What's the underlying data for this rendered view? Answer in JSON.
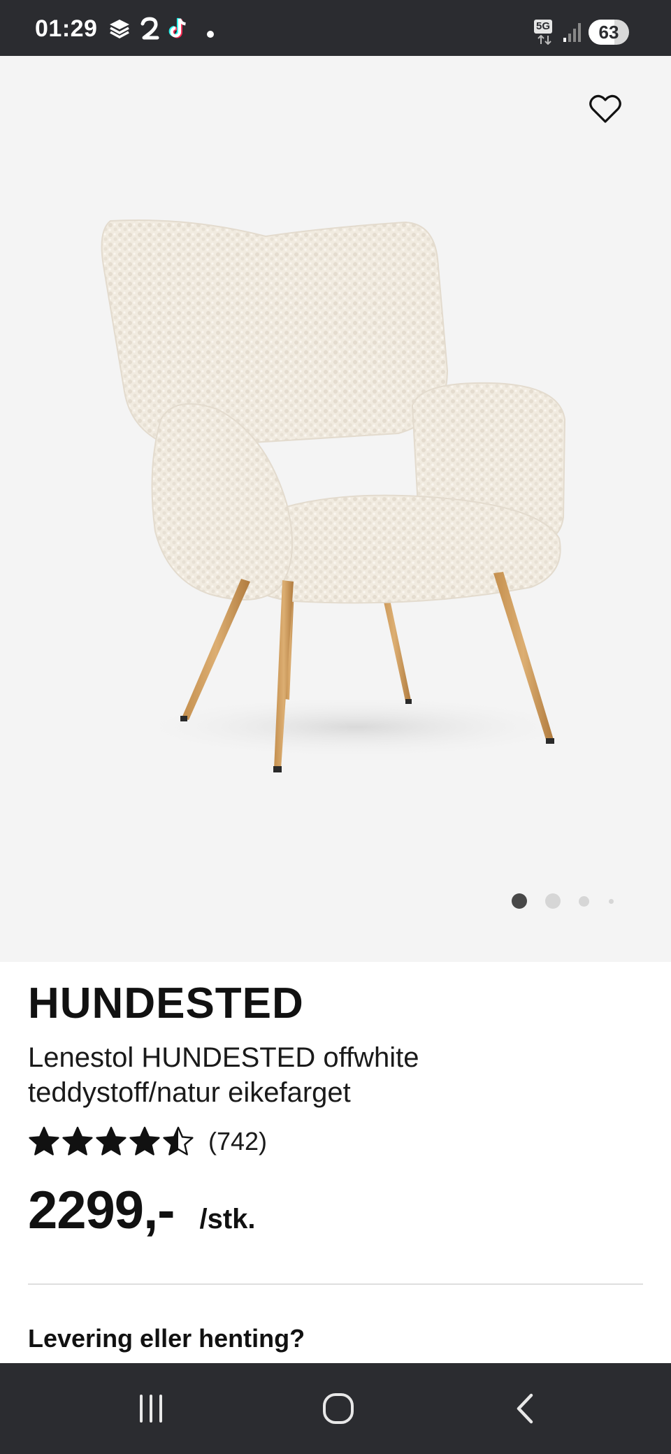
{
  "status_bar": {
    "time": "01:29",
    "network_label": "5G",
    "battery_level": "63",
    "battery_fraction": 0.63,
    "notification_icons": [
      "layers-icon",
      "number-2-icon",
      "tiktok-icon"
    ]
  },
  "product": {
    "image_alt_icon": "armchair-icon",
    "carousel": {
      "count": 4,
      "active_index": 0
    },
    "brand": "HUNDESTED",
    "description": "Lenestol HUNDESTED offwhite teddystoff/natur eikefarget",
    "rating": {
      "value": 4.5,
      "max": 5,
      "review_count": "(742)"
    },
    "price": "2299,-",
    "unit": "/stk."
  },
  "delivery": {
    "title": "Levering eller henting?"
  },
  "nav_bar": {
    "buttons": [
      "recent-apps-icon",
      "home-icon",
      "back-icon"
    ]
  },
  "colors": {
    "system_bar": "#2b2c30",
    "image_background": "#f4f4f4",
    "text": "#111111",
    "divider": "#dedede",
    "dot_active": "#484848",
    "dot_inactive": "#d6d6d6"
  }
}
